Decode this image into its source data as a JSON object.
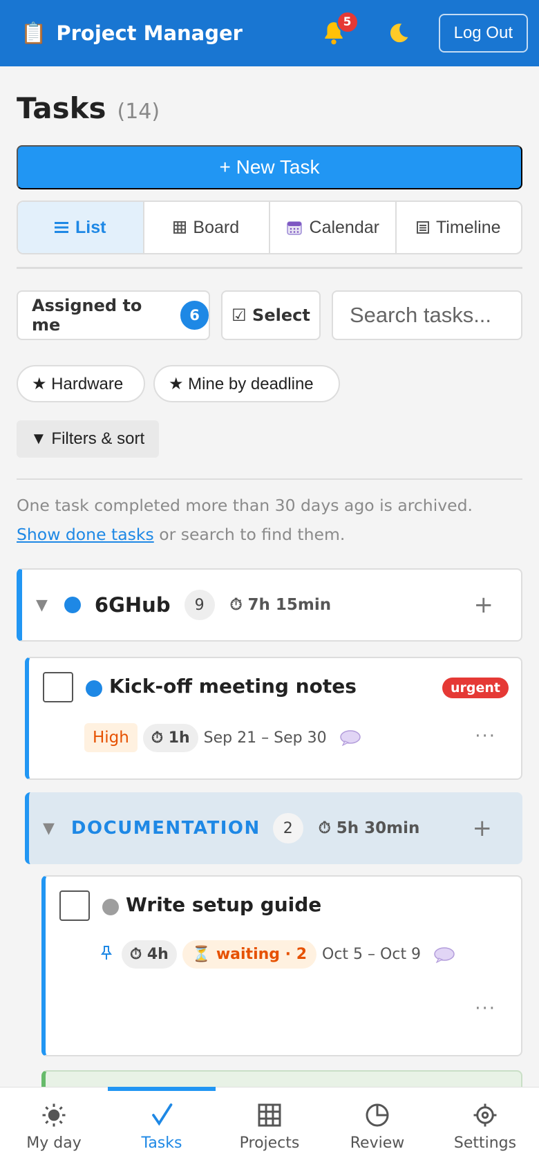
{
  "appbar": {
    "title": "Project Manager",
    "notifications_count": "5",
    "logout_label": "Log Out"
  },
  "page": {
    "title": "Tasks",
    "count": "(14)"
  },
  "new_task_label": "+ New Task",
  "views": [
    {
      "label": "List",
      "icon": "list-icon",
      "active": true
    },
    {
      "label": "Board",
      "icon": "grid-icon"
    },
    {
      "label": "Calendar",
      "icon": "calendar-icon"
    },
    {
      "label": "Timeline",
      "icon": "timeline-icon"
    }
  ],
  "toolbar": {
    "assigned_label": "Assigned to me",
    "assigned_count": "6",
    "select_label": "☑ Select",
    "search_placeholder": "Search tasks..."
  },
  "saved_filters": [
    {
      "label": "★ Hardware"
    },
    {
      "label": "★ Mine by deadline"
    }
  ],
  "filters_label": "▼ Filters & sort",
  "archive_note": {
    "text": "One task completed more than 30 days ago is archived.",
    "link": "Show done tasks",
    "suffix": " or search to find them."
  },
  "group": {
    "name": "6GHub",
    "count": "9",
    "total_time": "⏱ 7h 15min",
    "color": "#1e88e5"
  },
  "task1": {
    "title": "Kick-off meeting notes",
    "tag": "urgent",
    "priority": "High",
    "estimate": "⏱ 1h",
    "dates": "Sep 21 – Sep 30"
  },
  "subgroup": {
    "name": "DOCUMENTATION",
    "count": "2",
    "total_time": "⏱ 5h 30min"
  },
  "task2": {
    "title": "Write setup guide",
    "estimate": "⏱ 4h",
    "waiting": "⏳ waiting · 2",
    "dates": "Oct 5 – Oct 9"
  },
  "more_glyph": "···",
  "bottom_nav": [
    {
      "label": "My day",
      "icon": "sun-icon"
    },
    {
      "label": "Tasks",
      "icon": "check-icon",
      "active": true
    },
    {
      "label": "Projects",
      "icon": "grid-icon"
    },
    {
      "label": "Review",
      "icon": "pie-icon"
    },
    {
      "label": "Settings",
      "icon": "gear-icon"
    }
  ],
  "colors": {
    "primary": "#1976d2",
    "accent": "#2196f3",
    "urgent": "#e53935",
    "priority_high": "#e65100"
  }
}
